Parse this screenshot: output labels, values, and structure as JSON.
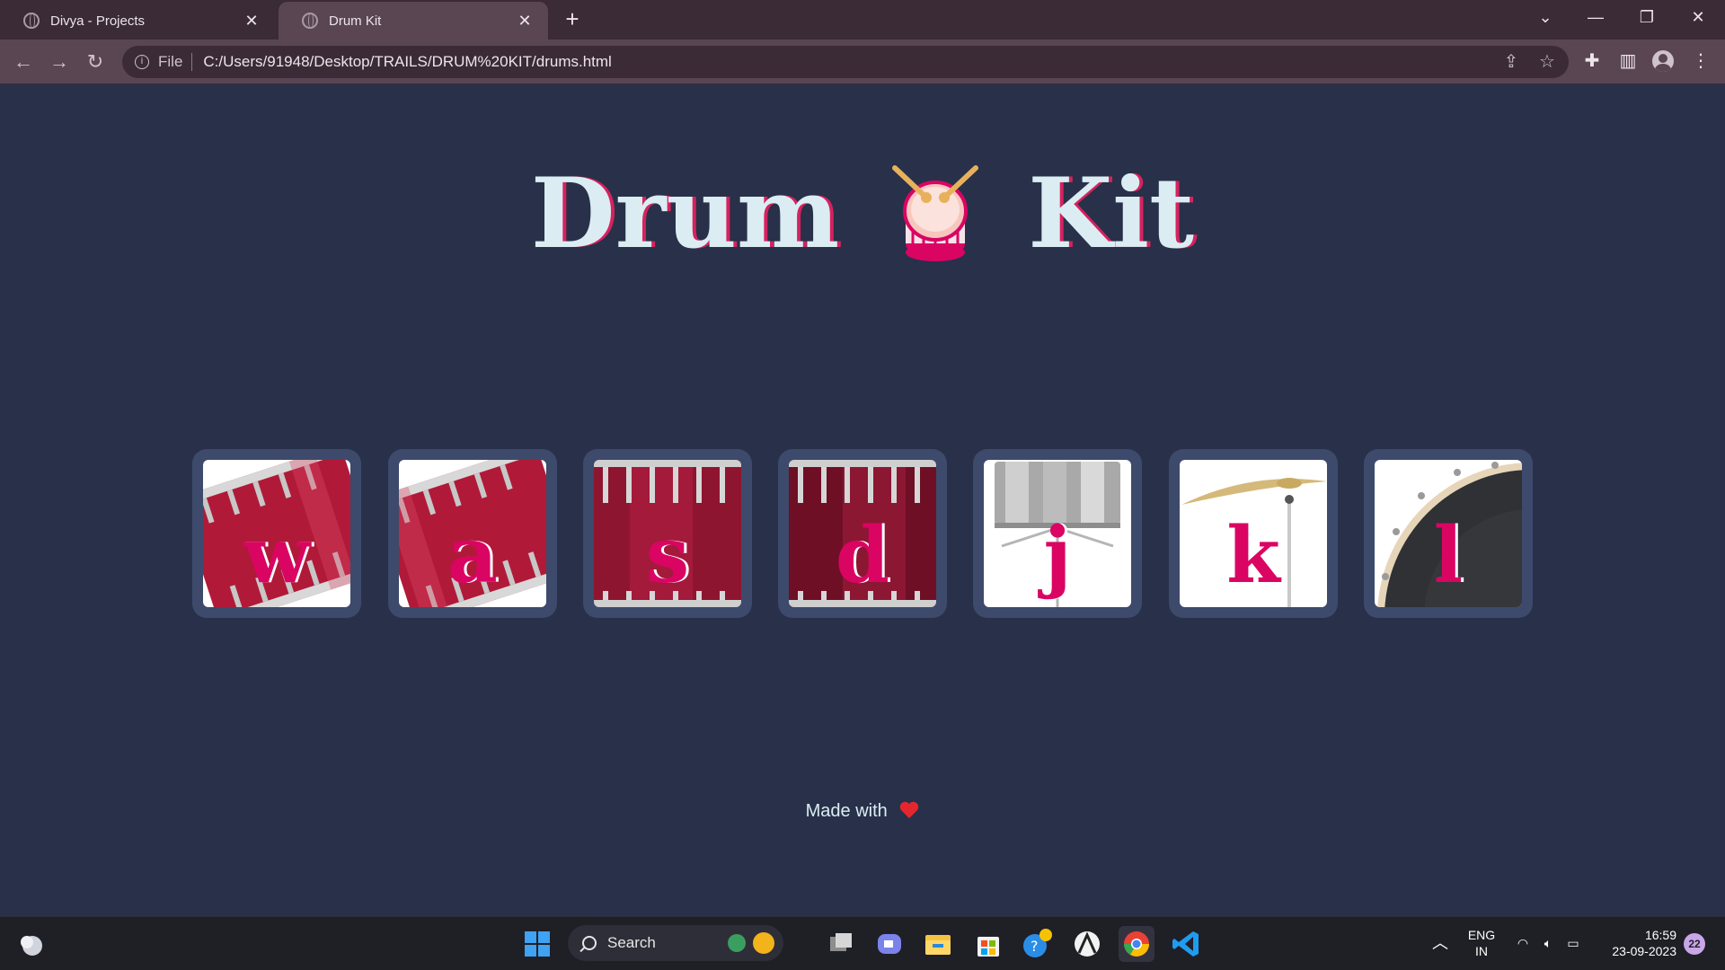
{
  "browser": {
    "tabs": [
      {
        "title": "Divya - Projects",
        "active": false
      },
      {
        "title": "Drum Kit",
        "active": true
      }
    ],
    "address": {
      "scheme_label": "File",
      "url": "C:/Users/91948/Desktop/TRAILS/DRUM%20KIT/drums.html"
    }
  },
  "page": {
    "title_left": "Drum",
    "title_right": "Kit",
    "drums": [
      {
        "key": "w",
        "image": "tom-tilted"
      },
      {
        "key": "a",
        "image": "tom-tilted"
      },
      {
        "key": "s",
        "image": "snare"
      },
      {
        "key": "d",
        "image": "snare-dark"
      },
      {
        "key": "j",
        "image": "hi-hat-drum"
      },
      {
        "key": "k",
        "image": "cymbal"
      },
      {
        "key": "l",
        "image": "bass-drum"
      }
    ],
    "footer": "Made with"
  },
  "taskbar": {
    "search_label": "Search",
    "lang_line1": "ENG",
    "lang_line2": "IN",
    "time": "16:59",
    "date": "23-09-2023",
    "notification_count": "22"
  },
  "colors": {
    "background": "#283149",
    "title_text": "#dbedf3",
    "accent": "#da0463",
    "button_frame": "#3d4a6b"
  }
}
